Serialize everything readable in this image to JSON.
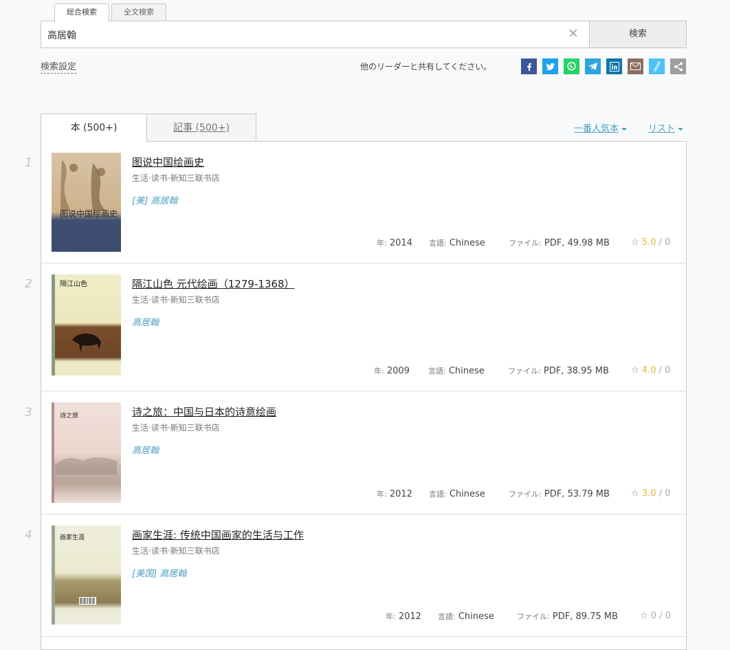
{
  "search_tabs": [
    {
      "label": "総合検索",
      "active": true
    },
    {
      "label": "全文検索",
      "active": false
    }
  ],
  "search": {
    "value": "高居翰",
    "clear_icon": "close-icon",
    "button_label": "検索"
  },
  "search_settings_label": "検索設定",
  "share": {
    "text": "他のリーダーと共有してください。",
    "icons": [
      {
        "name": "facebook-icon",
        "glyph": "f",
        "color": "#3b5998"
      },
      {
        "name": "twitter-icon",
        "glyph": "t",
        "color": "#1da1f2"
      },
      {
        "name": "whatsapp-icon",
        "glyph": "w",
        "color": "#25d366"
      },
      {
        "name": "telegram-icon",
        "glyph": "➤",
        "color": "#2fa4dc"
      },
      {
        "name": "linkedin-icon",
        "glyph": "in",
        "color": "#0e76a8"
      },
      {
        "name": "email-icon",
        "glyph": "✉",
        "color": "#8d6e63"
      },
      {
        "name": "link-icon",
        "glyph": "🔗",
        "color": "#4fc3f7"
      },
      {
        "name": "share-icon",
        "glyph": "⋖",
        "color": "#9e9e9e"
      }
    ]
  },
  "result_tabs": [
    {
      "label": "本 (500+)",
      "active": true
    },
    {
      "label": "記事 (500+)",
      "active": false
    }
  ],
  "sort": {
    "label": "一番人気本",
    "view_label": "リスト"
  },
  "meta_labels": {
    "year": "年:",
    "language": "言語:",
    "file": "ファイル:"
  },
  "books": [
    {
      "index": "1",
      "title": "图说中国绘画史",
      "publisher": "生活·读书·新知三联书店",
      "author": "[美] 高居翰",
      "year": "2014",
      "language": "Chinese",
      "file": "PDF, 49.98 MB",
      "rating": "5.0",
      "rating_count": "0",
      "cover_text": "图说中国绘画史"
    },
    {
      "index": "2",
      "title": "隔江山色 元代绘画（1279-1368）",
      "publisher": "生活·读书·新知三联书店",
      "author": "高居翰",
      "year": "2009",
      "language": "Chinese",
      "file": "PDF, 38.95 MB",
      "rating": "4.0",
      "rating_count": "0",
      "cover_text": "隔江山色"
    },
    {
      "index": "3",
      "title": "诗之旅：中国与日本的诗意绘画",
      "publisher": "生活·读书·新知三联书店",
      "author": "高居翰",
      "year": "2012",
      "language": "Chinese",
      "file": "PDF, 53.79 MB",
      "rating": "3.0",
      "rating_count": "0",
      "cover_text": "诗之旅"
    },
    {
      "index": "4",
      "title": "画家生涯: 传统中国画家的生活与工作",
      "publisher": "生活·读书·新知三联书店",
      "author": "[美国] 高居翰",
      "year": "2012",
      "language": "Chinese",
      "file": "PDF, 89.75 MB",
      "rating": "0",
      "rating_count": "0",
      "cover_text": "画家生涯"
    }
  ]
}
